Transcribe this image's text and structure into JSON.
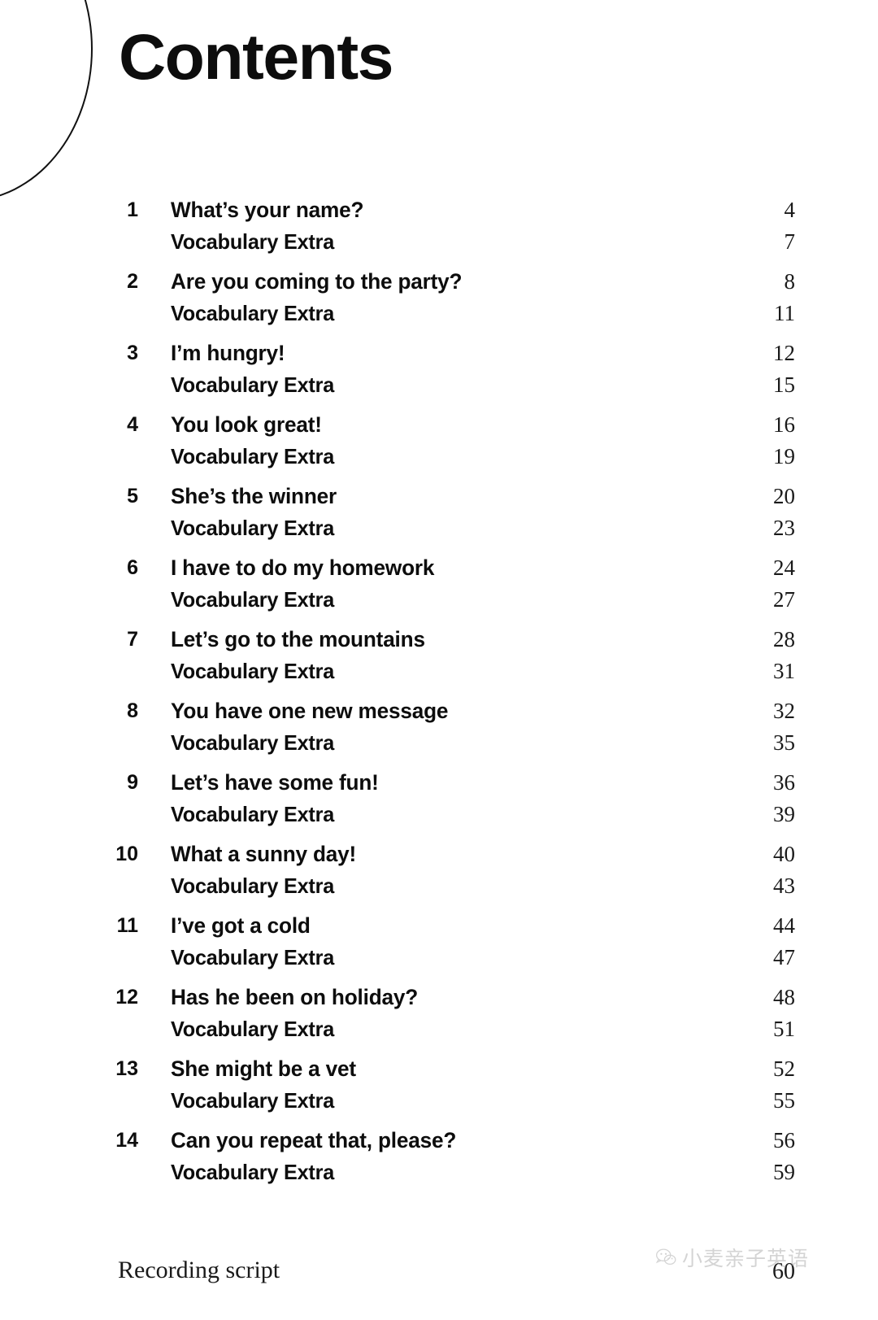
{
  "page": {
    "title": "Contents",
    "decoration": "circle-arc"
  },
  "toc": {
    "units": [
      {
        "number": "1",
        "title": "What’s your name?",
        "page": "4",
        "sub_label": "Vocabulary Extra",
        "sub_page": "7"
      },
      {
        "number": "2",
        "title": "Are you coming to the party?",
        "page": "8",
        "sub_label": "Vocabulary Extra",
        "sub_page": "11"
      },
      {
        "number": "3",
        "title": "I’m hungry!",
        "page": "12",
        "sub_label": "Vocabulary Extra",
        "sub_page": "15"
      },
      {
        "number": "4",
        "title": "You look great!",
        "page": "16",
        "sub_label": "Vocabulary Extra",
        "sub_page": "19"
      },
      {
        "number": "5",
        "title": "She’s the winner",
        "page": "20",
        "sub_label": "Vocabulary Extra",
        "sub_page": "23"
      },
      {
        "number": "6",
        "title": "I have to do my homework",
        "page": "24",
        "sub_label": "Vocabulary Extra",
        "sub_page": "27"
      },
      {
        "number": "7",
        "title": "Let’s go to the mountains",
        "page": "28",
        "sub_label": "Vocabulary Extra",
        "sub_page": "31"
      },
      {
        "number": "8",
        "title": "You have one new message",
        "page": "32",
        "sub_label": "Vocabulary Extra",
        "sub_page": "35"
      },
      {
        "number": "9",
        "title": "Let’s have some fun!",
        "page": "36",
        "sub_label": "Vocabulary Extra",
        "sub_page": "39"
      },
      {
        "number": "10",
        "title": "What a sunny day!",
        "page": "40",
        "sub_label": "Vocabulary Extra",
        "sub_page": "43"
      },
      {
        "number": "11",
        "title": "I’ve got a cold",
        "page": "44",
        "sub_label": "Vocabulary Extra",
        "sub_page": "47"
      },
      {
        "number": "12",
        "title": "Has he been on holiday?",
        "page": "48",
        "sub_label": "Vocabulary Extra",
        "sub_page": "51"
      },
      {
        "number": "13",
        "title": "She might be a vet",
        "page": "52",
        "sub_label": "Vocabulary Extra",
        "sub_page": "55"
      },
      {
        "number": "14",
        "title": "Can you repeat that, please?",
        "page": "56",
        "sub_label": "Vocabulary Extra",
        "sub_page": "59"
      }
    ]
  },
  "footer": {
    "label": "Recording script",
    "page": "60"
  },
  "watermark": {
    "text": "小麦亲子英语",
    "icon": "wechat-logo-icon",
    "color": "#9a9a9a"
  }
}
